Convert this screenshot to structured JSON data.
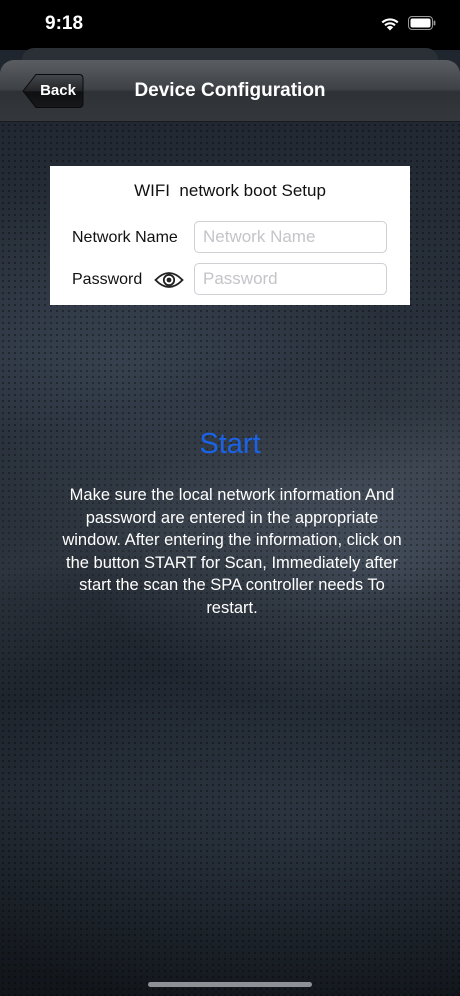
{
  "status_bar": {
    "time": "9:18",
    "icons": [
      "wifi-icon",
      "battery-icon"
    ]
  },
  "nav": {
    "back_label": "Back",
    "title": "Device Configuration"
  },
  "setup": {
    "title": "WIFI  network boot Setup",
    "network_label": "Network Name",
    "network_placeholder": "Network Name",
    "network_value": "",
    "password_label": "Password",
    "password_placeholder": "Password",
    "password_value": "",
    "visibility_icon": "eye-icon"
  },
  "start_label": "Start",
  "instructions": "Make sure the local network information And password are entered in the appropriate window. After entering the information, click on the button START for  Scan, Immediately after start the scan the SPA controller needs To restart.",
  "colors": {
    "accent": "#1a63e8",
    "panel": "#ffffff",
    "nav_top": "#5a5d62",
    "nav_bottom": "#2e3135"
  }
}
